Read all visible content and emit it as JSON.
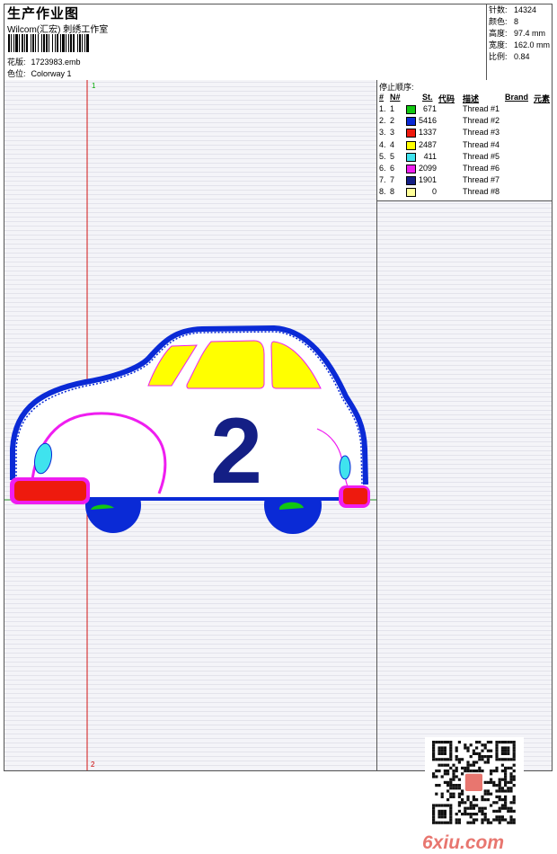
{
  "header": {
    "title": "生产作业图",
    "subtitle": "Wilcom(汇宏) 刺绣工作室",
    "design_label": "花版:",
    "design_value": "1723983.emb",
    "colorway_label": "色位:",
    "colorway_value": "Colorway 1"
  },
  "stats": [
    {
      "label": "针数:",
      "value": "14324"
    },
    {
      "label": "颜色:",
      "value": "8"
    },
    {
      "label": "高度:",
      "value": "97.4 mm"
    },
    {
      "label": "宽度:",
      "value": "162.0 mm"
    },
    {
      "label": "比例:",
      "value": "0.84"
    }
  ],
  "stop_sequence": {
    "label": "停止顺序:",
    "columns": [
      "#",
      "N#",
      "St.",
      "代码",
      "描述",
      "Brand",
      "元素"
    ],
    "rows": [
      {
        "idx": "1.",
        "n": "1",
        "color": "#11c711",
        "st": "671",
        "desc": "Thread #1"
      },
      {
        "idx": "2.",
        "n": "2",
        "color": "#0a2ad6",
        "st": "5416",
        "desc": "Thread #2"
      },
      {
        "idx": "3.",
        "n": "3",
        "color": "#ee1a0e",
        "st": "1337",
        "desc": "Thread #3"
      },
      {
        "idx": "4.",
        "n": "4",
        "color": "#ffff00",
        "st": "2487",
        "desc": "Thread #4"
      },
      {
        "idx": "5.",
        "n": "5",
        "color": "#3fe3ee",
        "st": "411",
        "desc": "Thread #5"
      },
      {
        "idx": "6.",
        "n": "6",
        "color": "#ef1ef0",
        "st": "2099",
        "desc": "Thread #6"
      },
      {
        "idx": "7.",
        "n": "7",
        "color": "#141f85",
        "st": "1901",
        "desc": "Thread #7"
      },
      {
        "idx": "8.",
        "n": "8",
        "color": "#ffff99",
        "st": "0",
        "desc": "Thread #8"
      }
    ]
  },
  "design": {
    "car_number": "2",
    "start_marker": "1",
    "end_marker": "2",
    "colors": {
      "outline": "#0a2ad6",
      "window": "#ffff00",
      "light": "#ee1a0e",
      "trim": "#ef1ef0",
      "wheel": "#0a2ad6",
      "hub": "#11c711",
      "lamp": "#3fe3ee",
      "number": "#141f85",
      "guide": "#d21414"
    }
  },
  "watermark": {
    "text": "6xiu.com",
    "color": "#e8766f"
  }
}
